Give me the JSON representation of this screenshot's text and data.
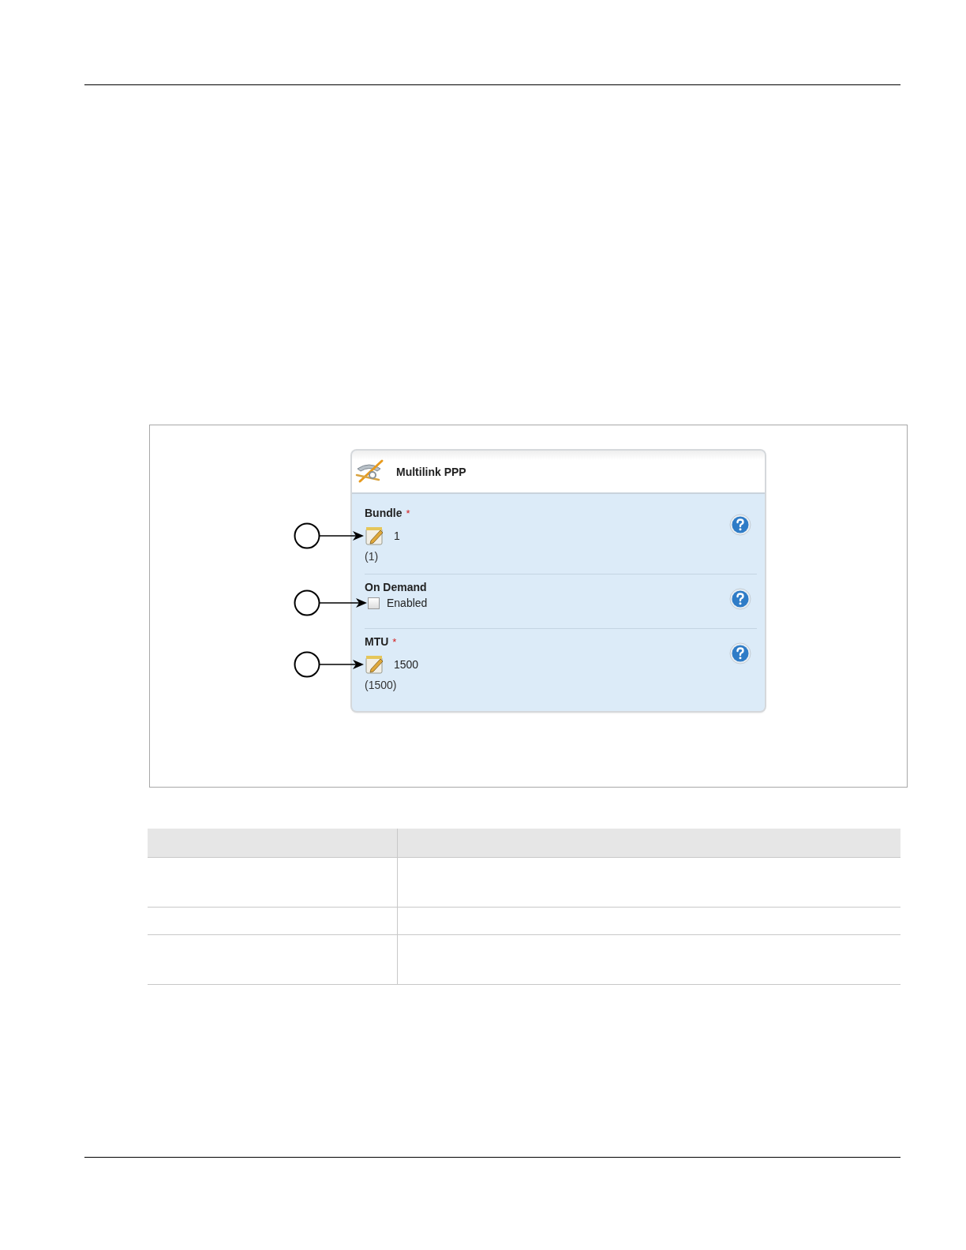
{
  "panel": {
    "title": "Multilink PPP",
    "fields": [
      {
        "kind": "edit",
        "label": "Bundle",
        "required_mark": "*",
        "value": "1",
        "default": "(1)",
        "callout": true
      },
      {
        "kind": "checkbox",
        "label": "On Demand",
        "option": "Enabled",
        "checked": false,
        "callout": true
      },
      {
        "kind": "edit",
        "label": "MTU",
        "required_mark": "*",
        "value": "1500",
        "default": "(1500)",
        "callout": true
      }
    ]
  }
}
